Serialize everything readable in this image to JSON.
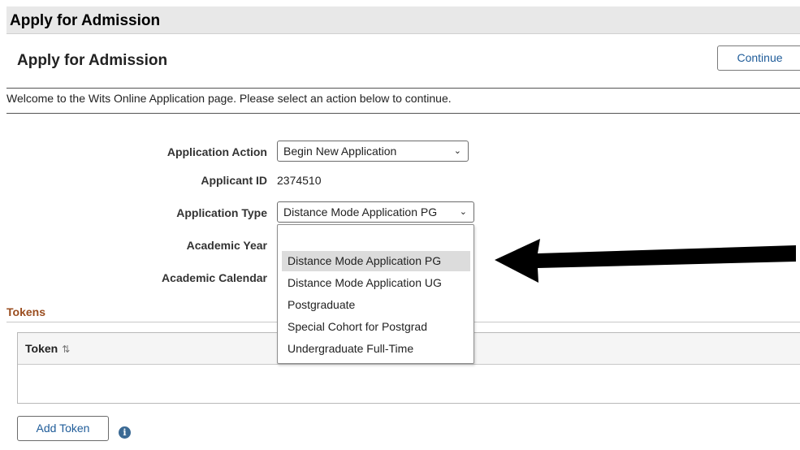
{
  "header": {
    "title": "Apply for Admission"
  },
  "page": {
    "title": "Apply for Admission",
    "continue_label": "Continue",
    "welcome": "Welcome to the Wits Online Application page. Please select an action below to continue."
  },
  "form": {
    "application_action": {
      "label": "Application Action",
      "value": "Begin New Application"
    },
    "applicant_id": {
      "label": "Applicant ID",
      "value": "2374510"
    },
    "application_type": {
      "label": "Application Type",
      "value": "Distance Mode Application PG"
    },
    "academic_year": {
      "label": "Academic Year"
    },
    "academic_calendar": {
      "label": "Academic Calendar"
    }
  },
  "dropdown": {
    "options": [
      "Distance Mode Application PG",
      "Distance Mode Application UG",
      "Postgraduate",
      "Special Cohort for Postgrad",
      "Undergraduate Full-Time"
    ],
    "highlighted_index": 0
  },
  "tokens": {
    "section_title": "Tokens",
    "column_header": "Token",
    "sort_icon": "sort-icon",
    "add_label": "Add Token",
    "info_icon": "info-icon"
  },
  "annotation": {
    "arrow_color": "#000000"
  }
}
